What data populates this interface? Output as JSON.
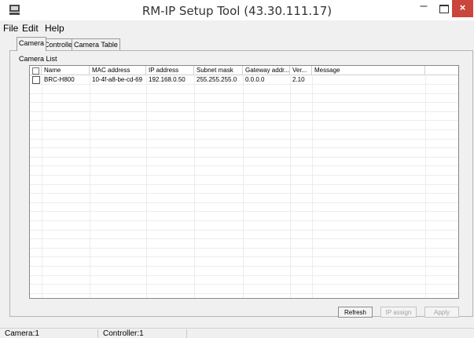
{
  "window": {
    "title": "RM-IP Setup Tool (43.30.111.17)",
    "close_glyph": "×",
    "minimize_glyph": "–"
  },
  "menu": [
    "File",
    "Edit",
    "Help"
  ],
  "tabs": [
    "Camera",
    "Controller",
    "Camera Table"
  ],
  "camera_list": {
    "label": "Camera List",
    "columns": [
      "Name",
      "MAC address",
      "IP address",
      "Subnet mask",
      "Gateway addr...",
      "Ver...",
      "Message"
    ],
    "rows": [
      {
        "checked": false,
        "name": "BRC-H800",
        "mac": "10-4f-a8-be-cd-69",
        "ip": "192.168.0.50",
        "subnet": "255.255.255.0",
        "gateway": "0.0.0.0",
        "version": "2.10",
        "message": ""
      }
    ]
  },
  "buttons": {
    "refresh": "Refresh",
    "ip_assign": "IP assign",
    "apply": "Apply"
  },
  "status": {
    "camera": "Camera:1",
    "controller": "Controller:1"
  }
}
